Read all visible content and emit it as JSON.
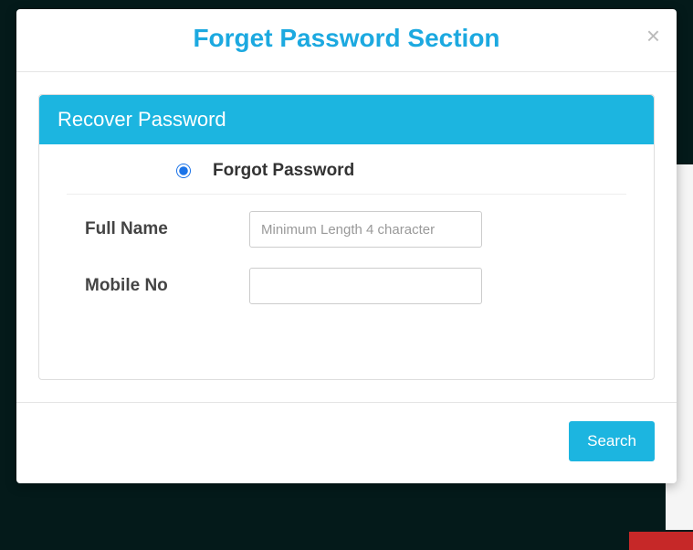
{
  "modal": {
    "title": "Forget Password Section",
    "close": "×"
  },
  "panel": {
    "header": "Recover Password"
  },
  "option": {
    "label": "Forgot Password"
  },
  "form": {
    "fullName": {
      "label": "Full Name",
      "placeholder": "Minimum Length 4 character",
      "value": ""
    },
    "mobileNo": {
      "label": "Mobile No",
      "value": ""
    }
  },
  "footer": {
    "searchLabel": "Search"
  }
}
